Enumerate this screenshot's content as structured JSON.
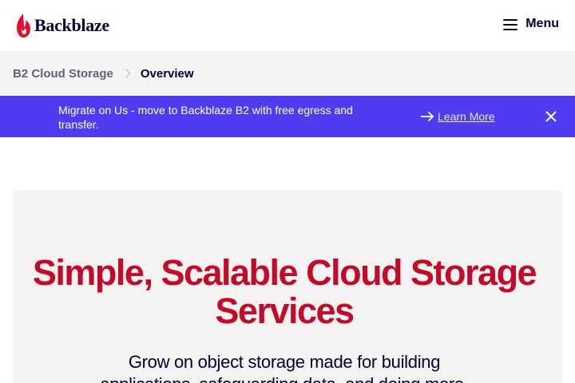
{
  "header": {
    "logo_text": "Backblaze",
    "menu_label": "Menu",
    "brand_color": "#e20e2f"
  },
  "breadcrumb": {
    "parent": "B2 Cloud Storage",
    "current": "Overview"
  },
  "banner": {
    "text": "Migrate on Us - move to Backblaze B2 with free egress and transfer.",
    "link_label": "Learn More",
    "background": "#4f3cf0",
    "icons": [
      "arrow-right-icon",
      "close-icon"
    ]
  },
  "hero": {
    "title": "Simple, Scalable Cloud Storage Services",
    "subtitle": "Grow on object storage made for building applications, safeguarding data, and doing more.",
    "title_color": "#c20a2b",
    "background": "#f4f3f2"
  }
}
